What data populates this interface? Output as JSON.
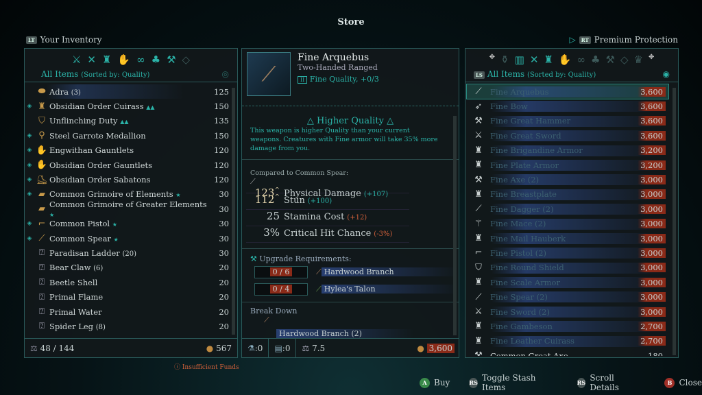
{
  "title": "Store",
  "left_header": {
    "button": "LT",
    "label": "Your Inventory"
  },
  "right_header": {
    "button": "RT",
    "label": "Premium Protection"
  },
  "inventory": {
    "filter": "All Items",
    "sort": "(Sorted by: Quality)",
    "items": [
      {
        "name": "Adra",
        "qty": "(3)",
        "price": "125",
        "icon": "ore-icon",
        "marked": false,
        "stars": ""
      },
      {
        "name": "Obsidian Order Cuirass",
        "qty": "",
        "price": "150",
        "icon": "armor-icon",
        "marked": true,
        "stars": "▲▲"
      },
      {
        "name": "Unflinching Duty",
        "qty": "",
        "price": "135",
        "icon": "shield-icon",
        "marked": false,
        "stars": "▲▲"
      },
      {
        "name": "Steel Garrote Medallion",
        "qty": "",
        "price": "150",
        "icon": "medallion-icon",
        "marked": true,
        "stars": ""
      },
      {
        "name": "Engwithan Gauntlets",
        "qty": "",
        "price": "120",
        "icon": "gauntlets-icon",
        "marked": true,
        "stars": ""
      },
      {
        "name": "Obsidian Order Gauntlets",
        "qty": "",
        "price": "120",
        "icon": "gauntlets-icon",
        "marked": true,
        "stars": ""
      },
      {
        "name": "Obsidian Order Sabatons",
        "qty": "",
        "price": "120",
        "icon": "boots-icon",
        "marked": true,
        "stars": ""
      },
      {
        "name": "Common Grimoire of Elements",
        "qty": "",
        "price": "30",
        "icon": "grimoire-icon",
        "marked": true,
        "stars": "★"
      },
      {
        "name": "Common Grimoire of Greater Elements",
        "qty": "",
        "price": "30",
        "icon": "grimoire-icon",
        "marked": false,
        "stars": "★"
      },
      {
        "name": "Common Pistol",
        "qty": "",
        "price": "30",
        "icon": "pistol-icon",
        "marked": true,
        "stars": "★"
      },
      {
        "name": "Common Spear",
        "qty": "",
        "price": "30",
        "icon": "spear-icon",
        "marked": true,
        "stars": "★"
      },
      {
        "name": "Paradisan Ladder",
        "qty": "(20)",
        "price": "30",
        "icon": "ingredient-icon",
        "marked": false,
        "stars": ""
      },
      {
        "name": "Bear Claw",
        "qty": "(6)",
        "price": "20",
        "icon": "ingredient-icon",
        "marked": false,
        "stars": ""
      },
      {
        "name": "Beetle Shell",
        "qty": "",
        "price": "20",
        "icon": "ingredient-icon",
        "marked": false,
        "stars": ""
      },
      {
        "name": "Primal Flame",
        "qty": "",
        "price": "20",
        "icon": "ingredient-icon",
        "marked": false,
        "stars": ""
      },
      {
        "name": "Primal Water",
        "qty": "",
        "price": "20",
        "icon": "ingredient-icon",
        "marked": false,
        "stars": ""
      },
      {
        "name": "Spider Leg",
        "qty": "(8)",
        "price": "20",
        "icon": "ingredient-icon",
        "marked": false,
        "stars": ""
      }
    ],
    "capacity": "48 / 144",
    "funds": "567",
    "warning": "Insufficient Funds"
  },
  "detail": {
    "name": "Fine Arquebus",
    "type": "Two-Handed Ranged",
    "quality": "Fine Quality, +0/3",
    "banner": "Higher Quality",
    "desc": "This weapon is higher Quality than your current weapons. Creatures with Fine armor will take 35% more damage from you.",
    "compared": "Compared to Common Spear:",
    "stats": [
      {
        "value": "123",
        "up": "^",
        "label": "Physical Damage",
        "delta": "(+107)",
        "good": true
      },
      {
        "value": "112",
        "up": "^",
        "label": "Stun",
        "delta": "(+100)",
        "good": true
      },
      {
        "value": "25",
        "up": "",
        "label": "Stamina Cost",
        "delta": "(+12)",
        "good": false
      },
      {
        "value": "3%",
        "up": "",
        "label": "Critical Hit Chance",
        "delta": "(-3%)",
        "good": false
      }
    ],
    "upgrade_title": "Upgrade Requirements:",
    "requirements": [
      {
        "count": "0 / 6",
        "item": "Hardwood Branch"
      },
      {
        "count": "0 / 4",
        "item": "Hylea's Talon"
      }
    ],
    "breakdown_title": "Break Down",
    "breakdown": "Hardwood Branch (2)",
    "footer": {
      "a": ":0",
      "b": ":0",
      "weight": "7.5",
      "price": "3,600"
    }
  },
  "store": {
    "filter": "All Items",
    "sort": "(Sorted by: Quality)",
    "items": [
      {
        "name": "Fine Arquebus",
        "price": "3,600",
        "icon": "gun-icon"
      },
      {
        "name": "Fine Bow",
        "price": "3,600",
        "icon": "bow-icon"
      },
      {
        "name": "Fine Great Hammer",
        "price": "3,600",
        "icon": "hammer-icon"
      },
      {
        "name": "Fine Great Sword",
        "price": "3,600",
        "icon": "sword-icon"
      },
      {
        "name": "Fine Brigandine Armor",
        "price": "3,200",
        "icon": "armor-icon"
      },
      {
        "name": "Fine Plate Armor",
        "price": "3,200",
        "icon": "armor-icon"
      },
      {
        "name": "Fine Axe (2)",
        "price": "3,000",
        "icon": "axe-icon"
      },
      {
        "name": "Fine Breastplate",
        "price": "3,000",
        "icon": "armor-icon"
      },
      {
        "name": "Fine Dagger (2)",
        "price": "3,000",
        "icon": "dagger-icon"
      },
      {
        "name": "Fine Mace (2)",
        "price": "3,000",
        "icon": "mace-icon"
      },
      {
        "name": "Fine Mail Hauberk",
        "price": "3,000",
        "icon": "armor-icon"
      },
      {
        "name": "Fine Pistol (2)",
        "price": "3,000",
        "icon": "pistol-icon"
      },
      {
        "name": "Fine Round Shield",
        "price": "3,000",
        "icon": "shield-icon"
      },
      {
        "name": "Fine Scale Armor",
        "price": "3,000",
        "icon": "armor-icon"
      },
      {
        "name": "Fine Spear (2)",
        "price": "3,000",
        "icon": "spear-icon"
      },
      {
        "name": "Fine Sword (2)",
        "price": "3,000",
        "icon": "sword-icon"
      },
      {
        "name": "Fine Gambeson",
        "price": "2,700",
        "icon": "armor-icon"
      },
      {
        "name": "Fine Leather Cuirass",
        "price": "2,700",
        "icon": "armor-icon"
      },
      {
        "name": "Common Great Axe",
        "price": "180",
        "icon": "axe-icon"
      }
    ]
  },
  "prompts": [
    {
      "btn": "A",
      "label": "Buy",
      "color": "#3a8a4a"
    },
    {
      "btn": "RS",
      "label": "Toggle Stash Items",
      "color": "#4a5656"
    },
    {
      "btn": "RS",
      "label": "Scroll Details",
      "color": "#4a5656"
    },
    {
      "btn": "B",
      "label": "Close",
      "color": "#a03028"
    }
  ]
}
